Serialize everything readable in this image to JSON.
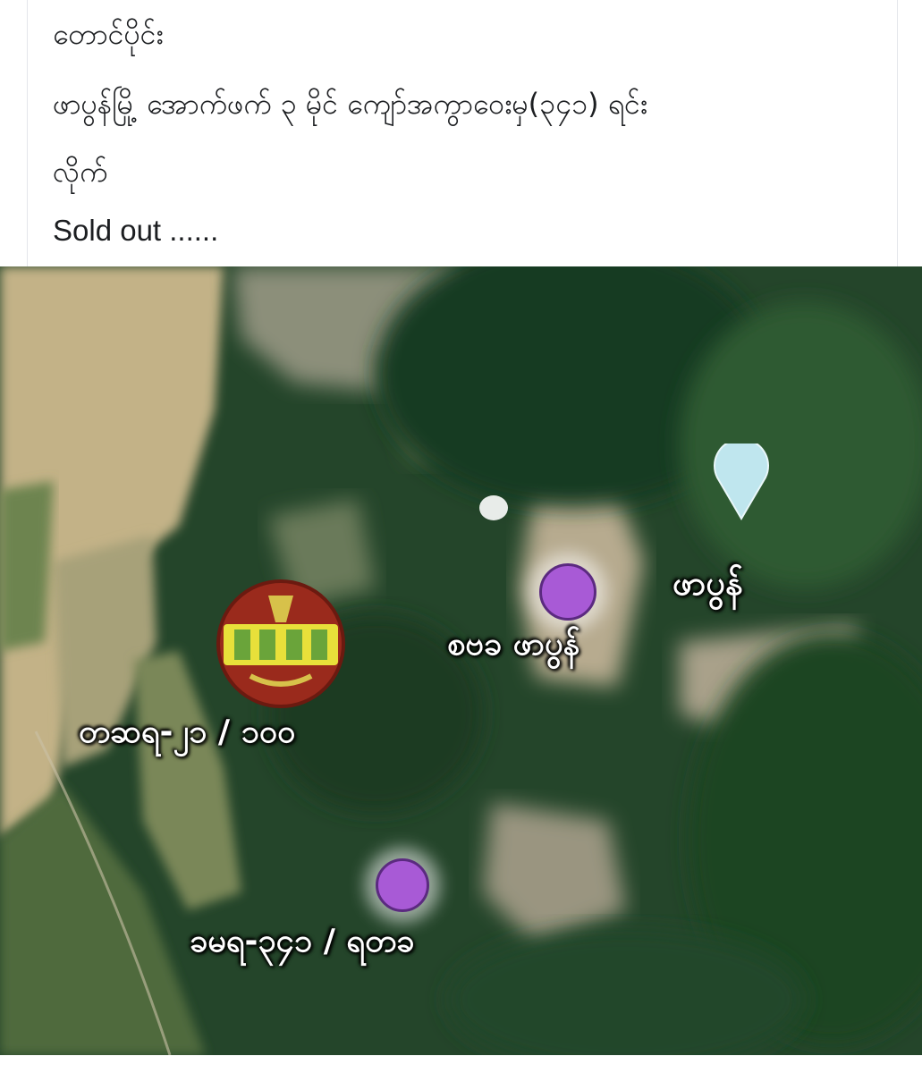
{
  "post": {
    "lines": [
      "တောင်ပိုင်း",
      "ဖာပွန်မြို့ အောက်ဖက် ၃ မိုင် ကျော်အကွာဝေးမှ(၃၄၁) ရင်း",
      "လိုက်",
      "Sold out ......"
    ]
  },
  "map": {
    "labels": {
      "top_right": "ဖာပွန်",
      "center": "စဗခ ဖာပွန်",
      "left": "တဆရ-၂၁ / ၁၀၀",
      "bottom": "ခမရ-၃၄၁ / ရတခ"
    },
    "colors": {
      "forest": "#274a2a",
      "field": "#c9b98c",
      "marker": "#a85ad6",
      "pin": "#bfe6ee",
      "emblem_red": "#9a2a1c",
      "emblem_yellow": "#e8e03a"
    },
    "icons": {
      "pin": "map-pin-icon",
      "marker": "location-dot-icon",
      "emblem": "military-emblem-icon"
    }
  }
}
